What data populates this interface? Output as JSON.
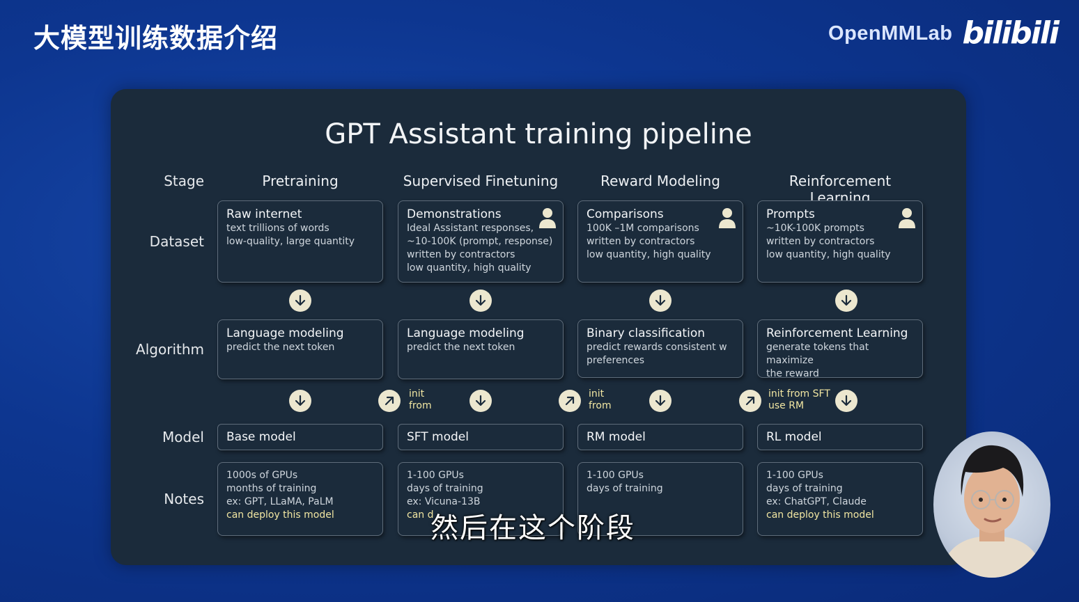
{
  "slide": {
    "title": "大模型训练数据介绍"
  },
  "brand": {
    "org": "OpenMMLab",
    "platform": "bilibili"
  },
  "panel": {
    "title": "GPT Assistant training pipeline"
  },
  "row_labels": {
    "stage": "Stage",
    "dataset": "Dataset",
    "algorithm": "Algorithm",
    "model": "Model",
    "notes": "Notes"
  },
  "stages": [
    {
      "name": "Pretraining",
      "dataset": {
        "title": "Raw internet",
        "lines": [
          "text trillions of words",
          "low-quality, large quantity"
        ],
        "human_icon": false
      },
      "algorithm": {
        "title": "Language modeling",
        "lines": [
          "predict the next token"
        ]
      },
      "model": "Base model",
      "notes": {
        "lines": [
          "1000s of GPUs",
          "months of training",
          "ex: GPT, LLaMA, PaLM"
        ],
        "accent": "can deploy this model"
      }
    },
    {
      "name": "Supervised Finetuning",
      "dataset": {
        "title": "Demonstrations",
        "lines": [
          "Ideal Assistant responses,",
          "~10-100K (prompt, response)",
          "written by contractors",
          "low quantity, high quality"
        ],
        "human_icon": true
      },
      "algorithm": {
        "title": "Language modeling",
        "lines": [
          "predict the next token"
        ]
      },
      "init_label": [
        "init",
        "from"
      ],
      "model": "SFT model",
      "notes": {
        "lines": [
          "1-100 GPUs",
          "days of training",
          "ex: Vicuna-13B"
        ],
        "accent": "can d"
      }
    },
    {
      "name": "Reward Modeling",
      "dataset": {
        "title": "Comparisons",
        "lines": [
          "100K –1M comparisons",
          "written by contractors",
          "low quantity, high quality"
        ],
        "human_icon": true
      },
      "algorithm": {
        "title": "Binary classification",
        "lines": [
          "predict rewards consistent w",
          "preferences"
        ]
      },
      "init_label": [
        "init",
        "from"
      ],
      "model": "RM model",
      "notes": {
        "lines": [
          "1-100 GPUs",
          "days of training"
        ],
        "accent": ""
      }
    },
    {
      "name": "Reinforcement Learning",
      "dataset": {
        "title": "Prompts",
        "lines": [
          "~10K-100K prompts",
          "written by contractors",
          "low quantity, high quality"
        ],
        "human_icon": true
      },
      "algorithm": {
        "title": "Reinforcement Learning",
        "lines": [
          "generate tokens that maximize",
          "the reward"
        ]
      },
      "init_label": [
        "init from SFT",
        "use RM"
      ],
      "model": "RL model",
      "notes": {
        "lines": [
          "1-100 GPUs",
          "days of training",
          "ex: ChatGPT, Claude"
        ],
        "accent": "can deploy this model"
      }
    }
  ],
  "subtitle": "然后在这个阶段",
  "colors": {
    "background": "#0d3690",
    "panel": "#1b2b3b",
    "box_border": "#5f6d7b",
    "accent_text": "#f1e6a2",
    "arrow_circle": "#ece7cf"
  }
}
